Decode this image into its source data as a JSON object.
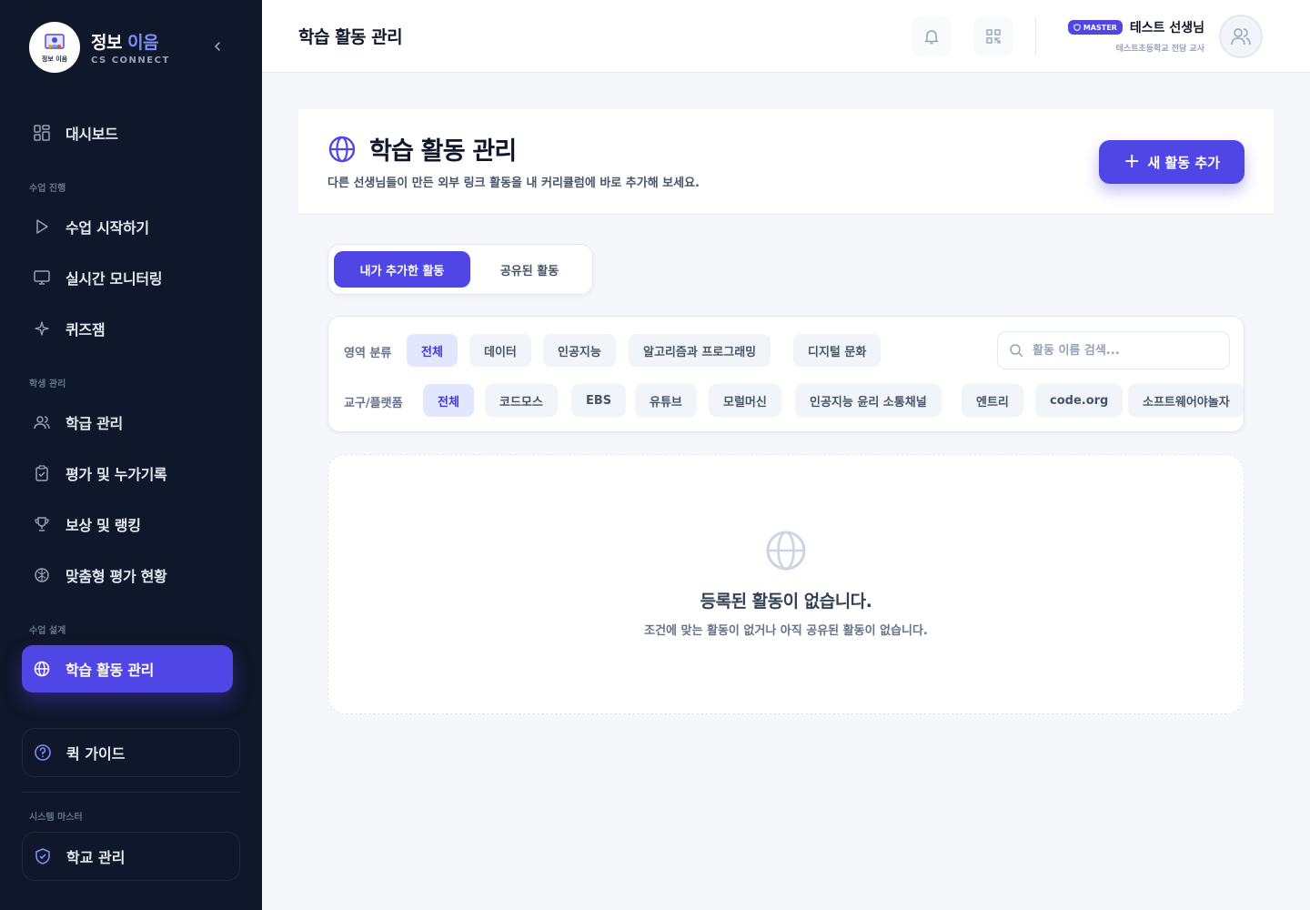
{
  "brand": {
    "title_main": "정보",
    "title_accent": "이음",
    "subtitle": "CS CONNECT",
    "logo_text": "정보 이음"
  },
  "sidebar": {
    "dashboard": "대시보드",
    "section_class": "수업 진행",
    "start_class": "수업 시작하기",
    "monitoring": "실시간 모니터링",
    "quiz": "퀴즈잼",
    "section_students": "학생 관리",
    "class_manage": "학급 관리",
    "evaluation": "평가 및 누가기록",
    "rewards": "보상 및 랭킹",
    "adaptive": "맞춤형 평가 현황",
    "section_design": "수업 설계",
    "activity_manage": "학습 활동 관리",
    "quick_guide": "퀵 가이드",
    "section_master": "시스템 마스터",
    "school_manage": "학교 관리"
  },
  "header": {
    "title": "학습 활동 관리",
    "badge": "MASTER",
    "user_name": "테스트 선생님",
    "user_school": "테스트초등학교 전담 교사"
  },
  "page": {
    "title": "학습 활동 관리",
    "description": "다른 선생님들이 만든 외부 링크 활동을 내 커리큘럼에 바로 추가해 보세요.",
    "add_button": "새 활동 추가",
    "add_plus": "+"
  },
  "tabs": {
    "mine": "내가 추가한 활동",
    "shared": "공유된 활동"
  },
  "filters": {
    "area_label": "영역 분류",
    "area_chips": [
      "전체",
      "데이터",
      "인공지능",
      "알고리즘과 프로그래밍",
      "디지털 문화"
    ],
    "tool_label": "교구/플랫폼",
    "tool_chips": [
      "전체",
      "코드모스",
      "EBS",
      "유튜브",
      "모럴머신",
      "인공지능 윤리 소통채널",
      "엔트리",
      "code.org",
      "소프트웨어야놀자"
    ],
    "search_placeholder": "활동 이름 검색..."
  },
  "empty": {
    "title": "등록된 활동이 없습니다.",
    "description": "조건에 맞는 활동이 없거나 아직 공유된 활동이 없습니다."
  },
  "colors": {
    "primary": "#4f46e5",
    "sidebar_bg": "#0f172a",
    "chip_selected_bg": "#e0e7ff"
  }
}
